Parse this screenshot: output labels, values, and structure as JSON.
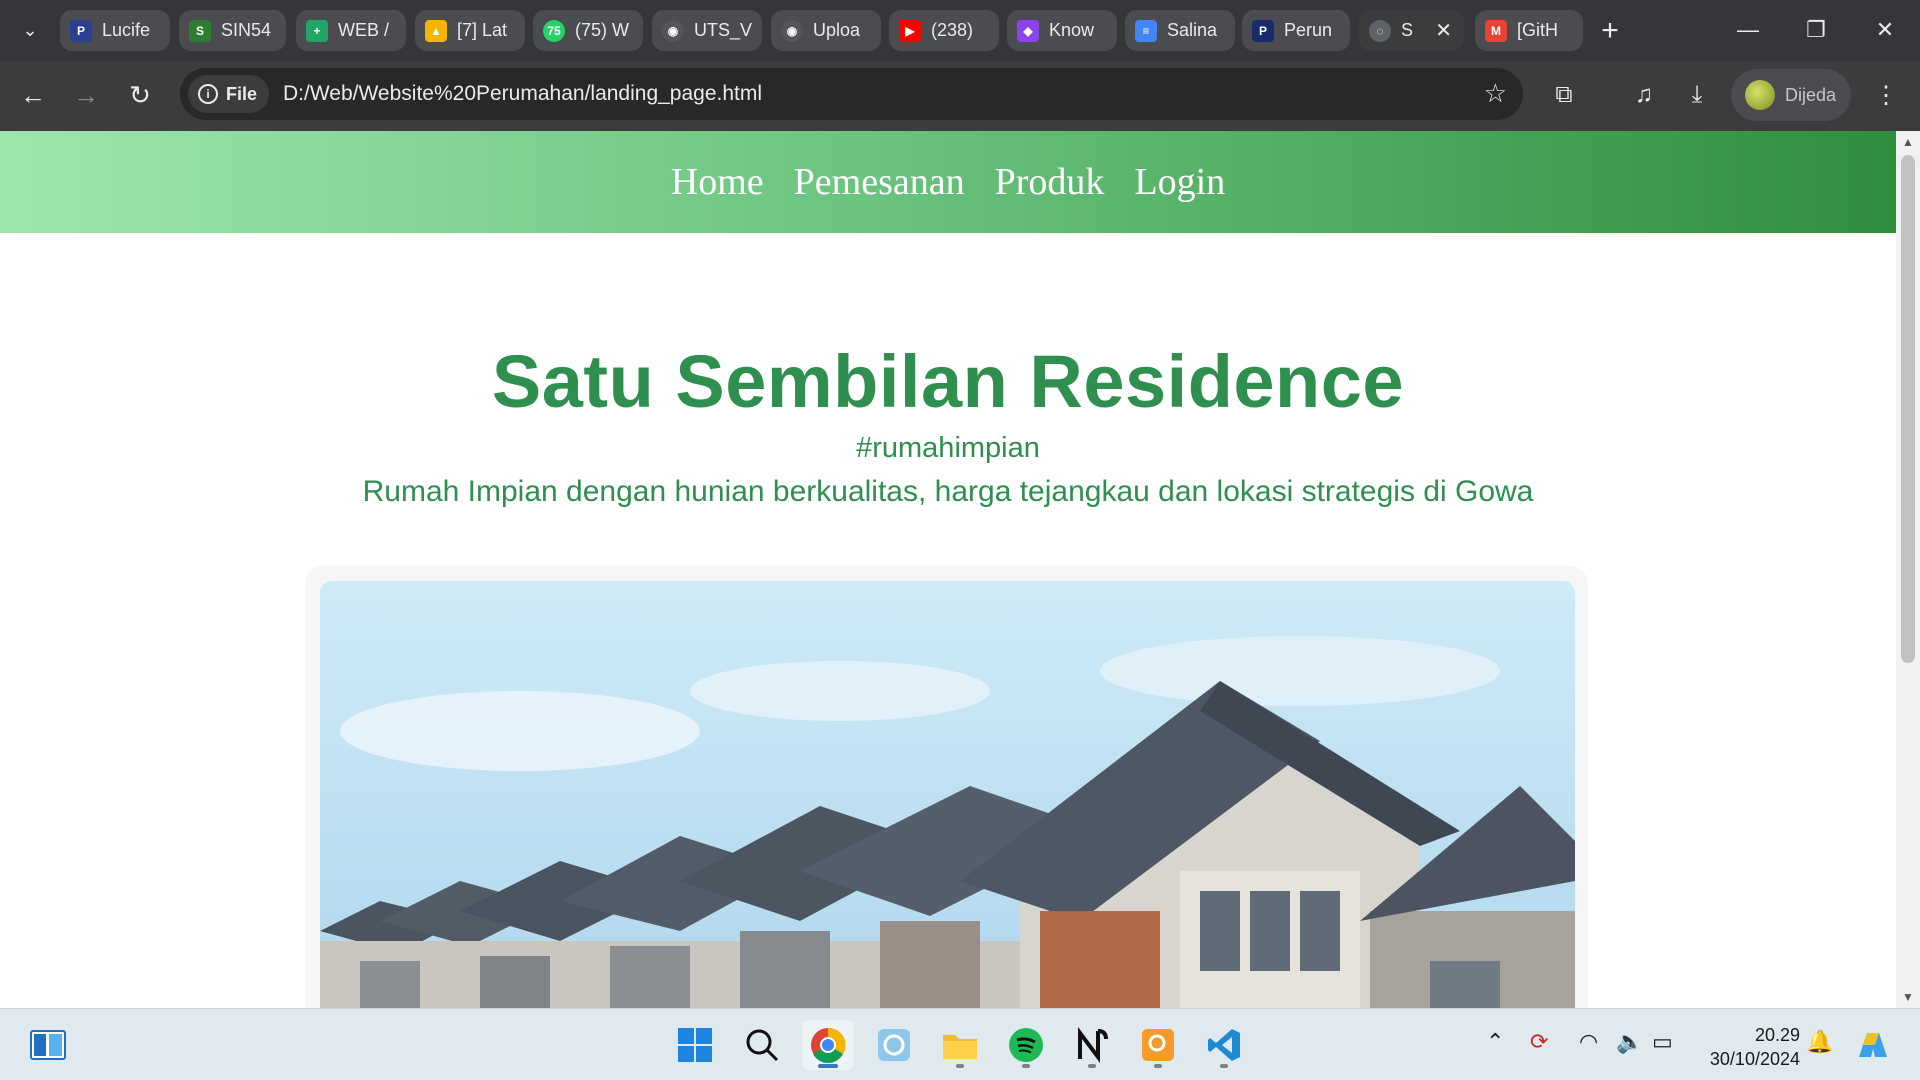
{
  "browser": {
    "tabs": [
      {
        "title": "Lucife",
        "favicon_color": "#2a3f8f",
        "favicon_text": "P"
      },
      {
        "title": "SIN54",
        "favicon_color": "#2e7d32",
        "favicon_text": "S"
      },
      {
        "title": "WEB /",
        "favicon_color": "#21a464",
        "favicon_text": "+"
      },
      {
        "title": "[7] Lat",
        "favicon_color": "#f4b400",
        "favicon_text": "▲"
      },
      {
        "title": "(75) W",
        "favicon_color": "#25d366",
        "favicon_text": "75"
      },
      {
        "title": "UTS_V",
        "favicon_color": "#555555",
        "favicon_text": "◉"
      },
      {
        "title": "Uploa",
        "favicon_color": "#555555",
        "favicon_text": "◉"
      },
      {
        "title": "(238)",
        "favicon_color": "#ff0000",
        "favicon_text": "▶"
      },
      {
        "title": "Know",
        "favicon_color": "#8e44ec",
        "favicon_text": "◆"
      },
      {
        "title": "Salina",
        "favicon_color": "#4285f4",
        "favicon_text": "≡"
      },
      {
        "title": "Perun",
        "favicon_color": "#1a2b6b",
        "favicon_text": "P"
      },
      {
        "title": "S",
        "favicon_color": "#5f6368",
        "favicon_text": "◌",
        "active": true
      },
      {
        "title": "[GitH",
        "favicon_color": "#ea4335",
        "favicon_text": "M"
      }
    ],
    "omnibox": {
      "chip_label": "File",
      "url": "D:/Web/Website%20Perumahan/landing_page.html"
    },
    "profile_label": "Dijeda"
  },
  "site": {
    "nav": [
      "Home",
      "Pemesanan",
      "Produk",
      "Login"
    ],
    "hero": {
      "title": "Satu Sembilan Residence",
      "tagline": "#rumahimpian",
      "description": "Rumah Impian dengan hunian berkualitas, harga tejangkau dan lokasi strategis di Gowa"
    }
  },
  "taskbar": {
    "time": "20.29",
    "date": "30/10/2024"
  }
}
